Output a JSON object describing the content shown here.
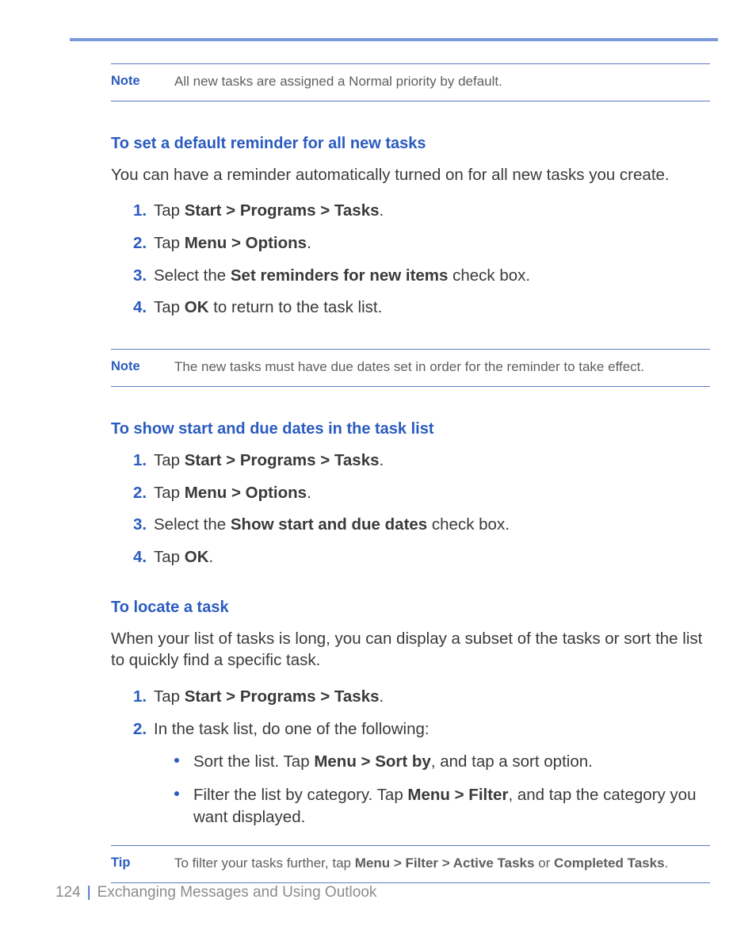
{
  "note1": {
    "label": "Note",
    "text": "All new tasks are assigned a Normal priority by default."
  },
  "section1": {
    "heading": "To set a default reminder for all new tasks",
    "body": "You can have a reminder automatically turned on for all new tasks you create.",
    "steps": [
      {
        "num": "1.",
        "html": "Tap <b>Start > Programs > Tasks</b>."
      },
      {
        "num": "2.",
        "html": "Tap <b>Menu > Options</b>."
      },
      {
        "num": "3.",
        "html": "Select the <b>Set reminders for new items</b> check box."
      },
      {
        "num": "4.",
        "html": "Tap <b>OK</b> to return to the task list."
      }
    ]
  },
  "note2": {
    "label": "Note",
    "text": "The new tasks must have due dates set in order for the reminder to take effect."
  },
  "section2": {
    "heading": "To show start and due dates in the task list",
    "steps": [
      {
        "num": "1.",
        "html": "Tap <b>Start > Programs > Tasks</b>."
      },
      {
        "num": "2.",
        "html": "Tap <b>Menu > Options</b>."
      },
      {
        "num": "3.",
        "html": "Select the <b>Show start and due dates</b> check box."
      },
      {
        "num": "4.",
        "html": "Tap <b>OK</b>."
      }
    ]
  },
  "section3": {
    "heading": "To locate a task",
    "body": "When your list of tasks is long, you can display a subset of the tasks or sort the list to quickly find a specific task.",
    "steps": [
      {
        "num": "1.",
        "html": "Tap <b>Start > Programs > Tasks</b>."
      },
      {
        "num": "2.",
        "html": "In the task list, do one of the following:",
        "sub": [
          {
            "html": "Sort the list. Tap <b>Menu > Sort by</b>, and tap a sort option."
          },
          {
            "html": "Filter the list by category. Tap <b>Menu > Filter</b>, and tap the category you want displayed."
          }
        ]
      }
    ]
  },
  "tip": {
    "label": "Tip",
    "html": "To filter your tasks further, tap <b>Menu > Filter > Active Tasks</b> or <b>Completed Tasks</b>."
  },
  "footer": {
    "page_number": "124",
    "divider": "|",
    "chapter": "Exchanging Messages and Using Outlook"
  }
}
